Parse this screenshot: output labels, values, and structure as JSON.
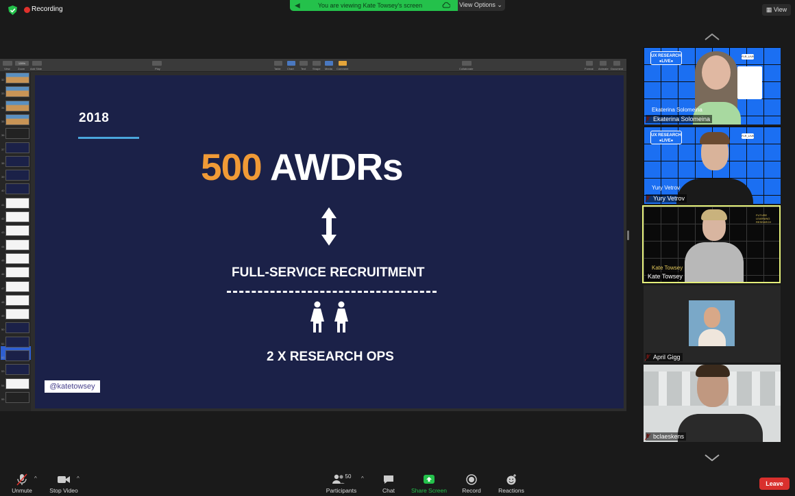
{
  "topbar": {
    "recording_label": "Recording",
    "viewing_text": "You are viewing Kate Towsey's screen",
    "view_options_label": "View Options ⌄",
    "view_button_label": "View",
    "icons": [
      "shield-icon",
      "recording-dot-icon",
      "speaker-icon",
      "cloud-icon",
      "view-grid-icon"
    ]
  },
  "keynote": {
    "toolbar_labels": [
      "View",
      "Zoom",
      "Add Slide",
      "Play",
      "Table",
      "Chart",
      "Text",
      "Shape",
      "Media",
      "Comment",
      "Collaborate",
      "Format",
      "Animate",
      "Document"
    ],
    "zoom_value": "135%",
    "slide_numbers": [
      "32",
      "33",
      "34",
      "35",
      "36",
      "37",
      "38",
      "39",
      "40",
      "41",
      "42",
      "43",
      "44",
      "45",
      "46",
      "47",
      "48",
      "49",
      "50",
      "51",
      "52",
      "53",
      "54",
      "55"
    ]
  },
  "slide": {
    "year": "2018",
    "headline_number": "500",
    "headline_text": "AWDRs",
    "line1": "FULL-SERVICE RECRUITMENT",
    "line2": "2 X RESEARCH OPS",
    "handle": "@katetowsey",
    "accent_colors": {
      "orange": "#f09a36",
      "navy": "#1b2148",
      "blue_line": "#4aa6dc"
    }
  },
  "participants": [
    {
      "name": "Ekaterina Solomeina",
      "bg_name": "Ekaterina Solomeina",
      "badge": "UX RESEARCH ●LIVE●",
      "muted": true
    },
    {
      "name": "Yury Vetrov",
      "bg_name": "Yury Vetrov",
      "badge": "UX RESEARCH ●LIVE●",
      "muted": true
    },
    {
      "name": "Kate Towsey",
      "bg_name": "Kate Towsey",
      "active_speaker": true,
      "muted": false
    },
    {
      "name": "April Gigg",
      "muted": true
    },
    {
      "name": "bclaeskens",
      "muted": true
    }
  ],
  "bottombar": {
    "unmute": "Unmute",
    "stop_video": "Stop Video",
    "participants": "Participants",
    "participants_count": "50",
    "chat": "Chat",
    "share_screen": "Share Screen",
    "record": "Record",
    "reactions": "Reactions",
    "leave": "Leave",
    "share_color": "#24c14b",
    "leave_color": "#d9302d"
  }
}
